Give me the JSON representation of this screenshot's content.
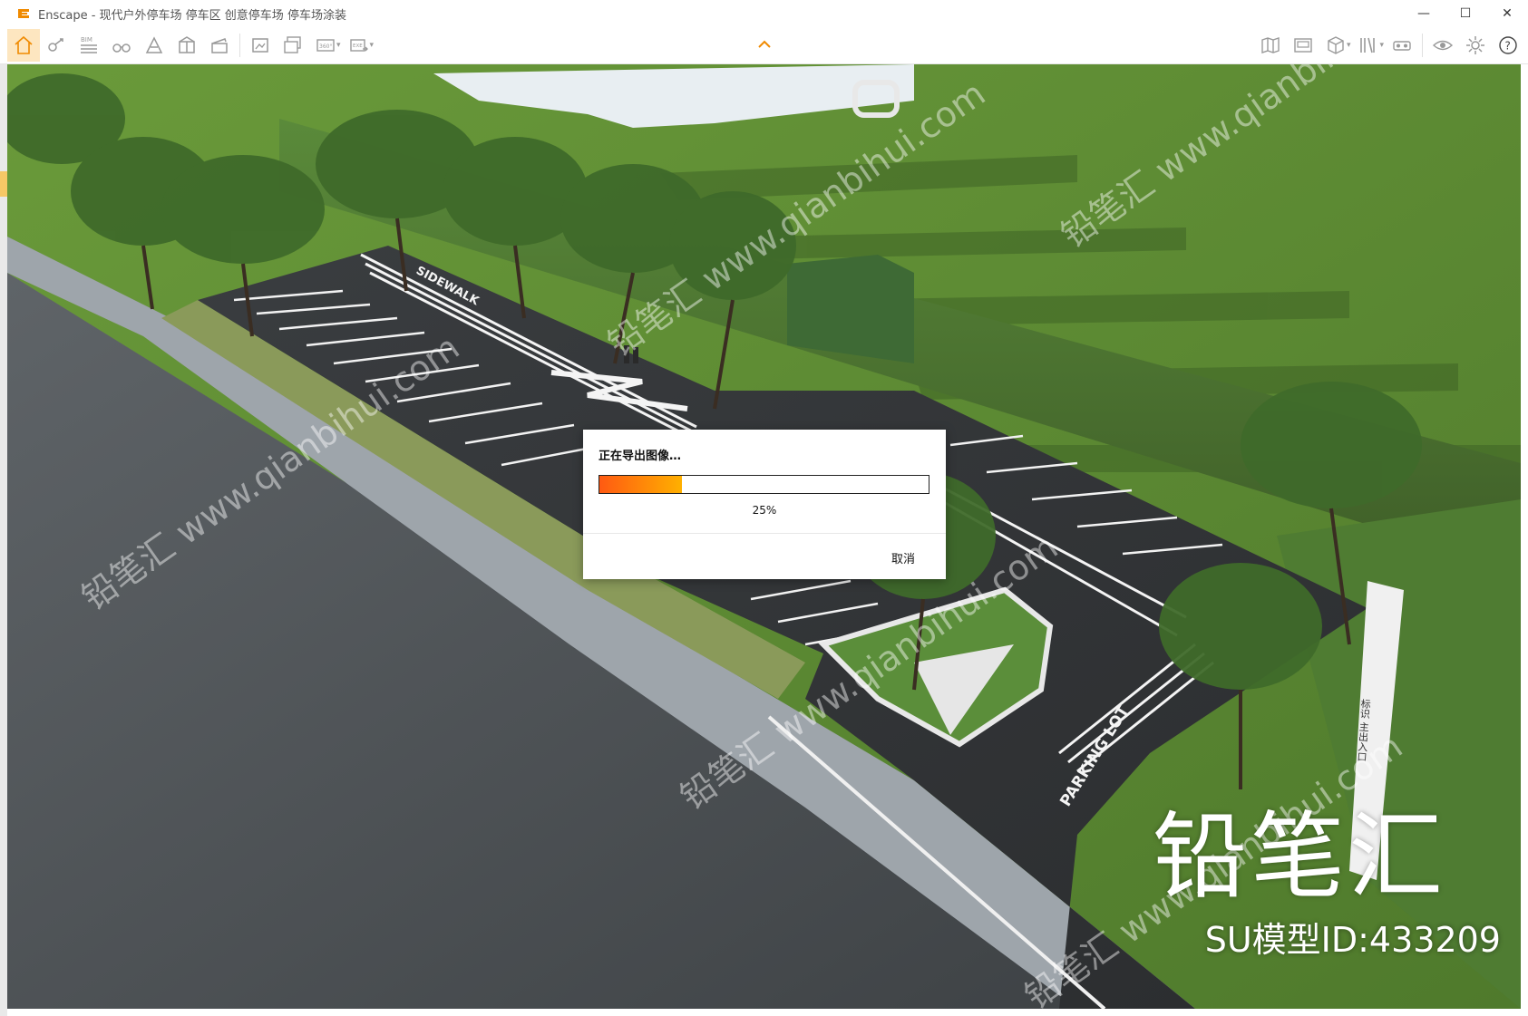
{
  "window": {
    "app_name": "Enscape",
    "title": "Enscape - 现代户外停车场 停车区 创意停车场 停车场涂装",
    "controls": {
      "minimize": "—",
      "maximize": "☐",
      "close": "✕"
    }
  },
  "toolbar": {
    "left_icons": [
      {
        "name": "home-icon",
        "active": true
      },
      {
        "name": "sync-link-icon"
      },
      {
        "name": "bim-icon",
        "label": "BIM"
      },
      {
        "name": "binoculars-icon"
      },
      {
        "name": "atmosphere-icon"
      },
      {
        "name": "asset-library-icon"
      },
      {
        "name": "clapper-icon"
      },
      {
        "name": "screenshot-export-icon"
      },
      {
        "name": "batch-export-icon"
      },
      {
        "name": "panorama-360-icon",
        "label": "360°"
      },
      {
        "name": "exe-export-icon",
        "label": "EXE"
      }
    ],
    "right_icons": [
      {
        "name": "map-icon"
      },
      {
        "name": "video-editor-icon"
      },
      {
        "name": "cube-view-icon"
      },
      {
        "name": "book-icon"
      },
      {
        "name": "vr-headset-icon"
      },
      {
        "name": "eye-icon"
      },
      {
        "name": "settings-gear-icon"
      },
      {
        "name": "help-icon",
        "label": "?"
      }
    ],
    "collapse_chevron": "^"
  },
  "viewport": {
    "road_labels": [
      "SIDEWALK",
      "PARKING LOT"
    ],
    "sign_text": "标识 主出入口"
  },
  "dialog": {
    "title": "正在导出图像…",
    "progress_fraction": 0.25,
    "progress_label": "25%",
    "cancel_label": "取消"
  },
  "watermark": {
    "brand": "铅笔汇",
    "model_id": "SU模型ID:433209",
    "tile_text": "铅笔汇 www.qianbihui.com"
  },
  "colors": {
    "progress_start": "#ff5a12",
    "progress_end": "#ffb000",
    "active_tab": "#fde6c0",
    "accent_orange": "#f08a00"
  }
}
